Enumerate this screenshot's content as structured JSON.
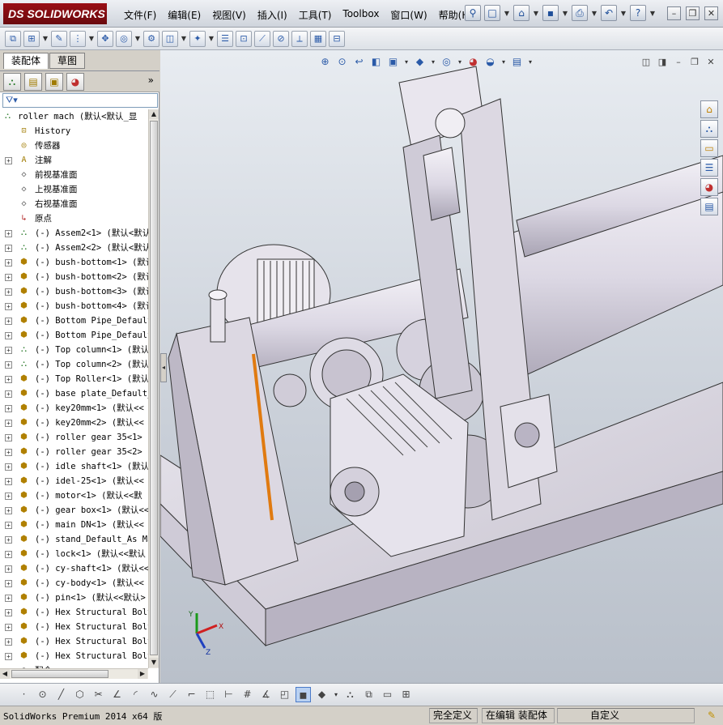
{
  "app": {
    "logo": "DS SOLIDWORKS"
  },
  "menu": [
    {
      "label": "文件(F)"
    },
    {
      "label": "编辑(E)"
    },
    {
      "label": "视图(V)"
    },
    {
      "label": "插入(I)"
    },
    {
      "label": "工具(T)"
    },
    {
      "label": "Toolbox"
    },
    {
      "label": "窗口(W)"
    },
    {
      "label": "帮助(H)"
    }
  ],
  "panel": {
    "tabs": [
      {
        "label": "装配体"
      },
      {
        "label": "草图"
      }
    ],
    "expand_symbol": "»"
  },
  "tree": {
    "root_label": "roller mach  (默认<默认_显",
    "items": [
      {
        "label": "History",
        "icon": "history-icon",
        "expandable": false
      },
      {
        "label": "传感器",
        "icon": "sensor-icon",
        "expandable": false
      },
      {
        "label": "注解",
        "icon": "annotation-icon",
        "expandable": true
      },
      {
        "label": "前视基准面",
        "icon": "plane-icon",
        "expandable": false
      },
      {
        "label": "上视基准面",
        "icon": "plane-icon",
        "expandable": false
      },
      {
        "label": "右视基准面",
        "icon": "plane-icon",
        "expandable": false
      },
      {
        "label": "原点",
        "icon": "origin-icon",
        "expandable": false
      },
      {
        "label": "(-) Assem2<1> (默认<默认",
        "icon": "subassembly-icon",
        "expandable": true
      },
      {
        "label": "(-) Assem2<2> (默认<默认",
        "icon": "subassembly-icon",
        "expandable": true
      },
      {
        "label": "(-) bush-bottom<1> (默认",
        "icon": "part-icon",
        "expandable": true
      },
      {
        "label": "(-) bush-bottom<2> (默认",
        "icon": "part-icon",
        "expandable": true
      },
      {
        "label": "(-) bush-bottom<3> (默认",
        "icon": "part-icon",
        "expandable": true
      },
      {
        "label": "(-) bush-bottom<4> (默认",
        "icon": "part-icon",
        "expandable": true
      },
      {
        "label": "(-) Bottom Pipe_Default",
        "icon": "part-icon",
        "expandable": true
      },
      {
        "label": "(-) Bottom Pipe_Default",
        "icon": "part-icon",
        "expandable": true
      },
      {
        "label": "(-) Top column<1> (默认",
        "icon": "subassembly-icon",
        "expandable": true
      },
      {
        "label": "(-) Top column<2> (默认",
        "icon": "subassembly-icon",
        "expandable": true
      },
      {
        "label": "(-) Top Roller<1> (默认",
        "icon": "part-icon",
        "expandable": true
      },
      {
        "label": "(-) base plate_Default_",
        "icon": "part-icon",
        "expandable": true
      },
      {
        "label": "(-) key20mm<1> (默认<<",
        "icon": "part-icon",
        "expandable": true
      },
      {
        "label": "(-) key20mm<2> (默认<<",
        "icon": "part-icon",
        "expandable": true
      },
      {
        "label": "(-) roller gear 35<1> (",
        "icon": "part-icon",
        "expandable": true
      },
      {
        "label": "(-) roller gear 35<2> (",
        "icon": "part-icon",
        "expandable": true
      },
      {
        "label": "(-) idle shaft<1> (默认",
        "icon": "part-icon",
        "expandable": true
      },
      {
        "label": "(-) idel-25<1> (默认<<",
        "icon": "part-icon",
        "expandable": true
      },
      {
        "label": "(-) motor<1> (默认<<默",
        "icon": "part-icon",
        "expandable": true
      },
      {
        "label": "(-) gear box<1> (默认<<",
        "icon": "part-icon",
        "expandable": true
      },
      {
        "label": "(-) main DN<1> (默认<<",
        "icon": "part-icon",
        "expandable": true
      },
      {
        "label": "(-) stand_Default_As Ma",
        "icon": "part-icon",
        "expandable": true
      },
      {
        "label": "(-) lock<1> (默认<<默认",
        "icon": "part-icon",
        "expandable": true
      },
      {
        "label": "(-) cy-shaft<1> (默认<<",
        "icon": "part-icon",
        "expandable": true
      },
      {
        "label": "(-) cy-body<1> (默认<<",
        "icon": "part-icon",
        "expandable": true
      },
      {
        "label": "(-) pin<1> (默认<<默认>",
        "icon": "part-icon",
        "expandable": true
      },
      {
        "label": "(-) Hex Structural Bolt",
        "icon": "part-icon",
        "expandable": true
      },
      {
        "label": "(-) Hex Structural Bolt",
        "icon": "part-icon",
        "expandable": true
      },
      {
        "label": "(-) Hex Structural Bolt",
        "icon": "part-icon",
        "expandable": true
      },
      {
        "label": "(-) Hex Structural Bolt",
        "icon": "part-icon",
        "expandable": true
      },
      {
        "label": "配合",
        "icon": "mates-icon",
        "expandable": false
      }
    ]
  },
  "triad": {
    "x": "X",
    "y": "Y",
    "z": "Z"
  },
  "status": {
    "product": "SolidWorks Premium 2014 x64 版",
    "under_defined": "完全定义",
    "editing": "在编辑 装配体",
    "custom": "自定义"
  },
  "colors": {
    "logo_red": "#9a0f16",
    "model_body": "#d9d5e0",
    "model_shadow": "#a8a3b2",
    "accent_orange": "#e07a10"
  }
}
